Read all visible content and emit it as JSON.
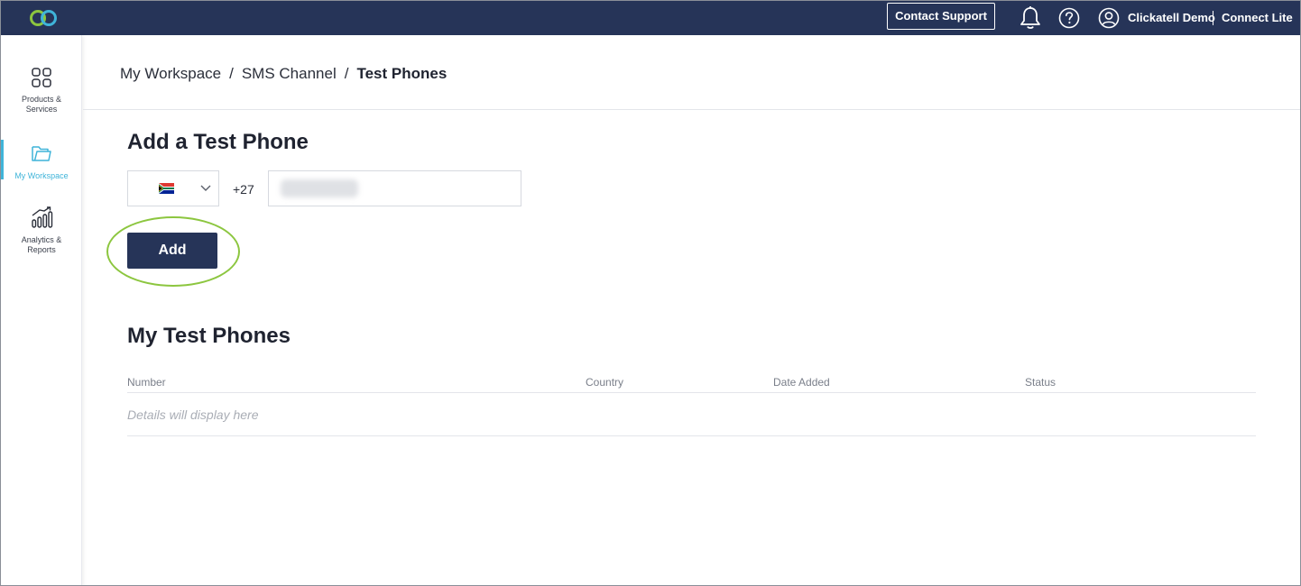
{
  "header": {
    "contact_support_label": "Contact Support",
    "user_name": "Clickatell Demo",
    "plan_name": "Connect Lite",
    "icons": {
      "logo": "clickatell-logo-icon",
      "notifications": "bell-icon",
      "help": "help-circle-icon",
      "account": "user-circle-icon"
    },
    "colors": {
      "bar": "#263458",
      "logo_green": "#8cc63f",
      "logo_blue": "#3fb4d9"
    }
  },
  "sidebar": {
    "items": [
      {
        "label": "Products & Services",
        "icon": "grid-icon",
        "active": false
      },
      {
        "label": "My Workspace",
        "icon": "folder-icon",
        "active": true
      },
      {
        "label": "Analytics & Reports",
        "icon": "bar-chart-icon",
        "active": false
      }
    ],
    "active_color": "#3fb4d9"
  },
  "breadcrumb": {
    "items": [
      "My Workspace",
      "SMS Channel",
      "Test Phones"
    ],
    "separator": "/"
  },
  "add_form": {
    "title": "Add a Test Phone",
    "country_flag": "south-africa-flag-icon",
    "dial_code": "+27",
    "phone_value": "",
    "add_label": "Add",
    "highlight_color": "#8cc63f"
  },
  "test_phones": {
    "title": "My Test Phones",
    "columns": [
      "Number",
      "Country",
      "Date Added",
      "Status"
    ],
    "rows": [],
    "empty_text": "Details will display here"
  }
}
